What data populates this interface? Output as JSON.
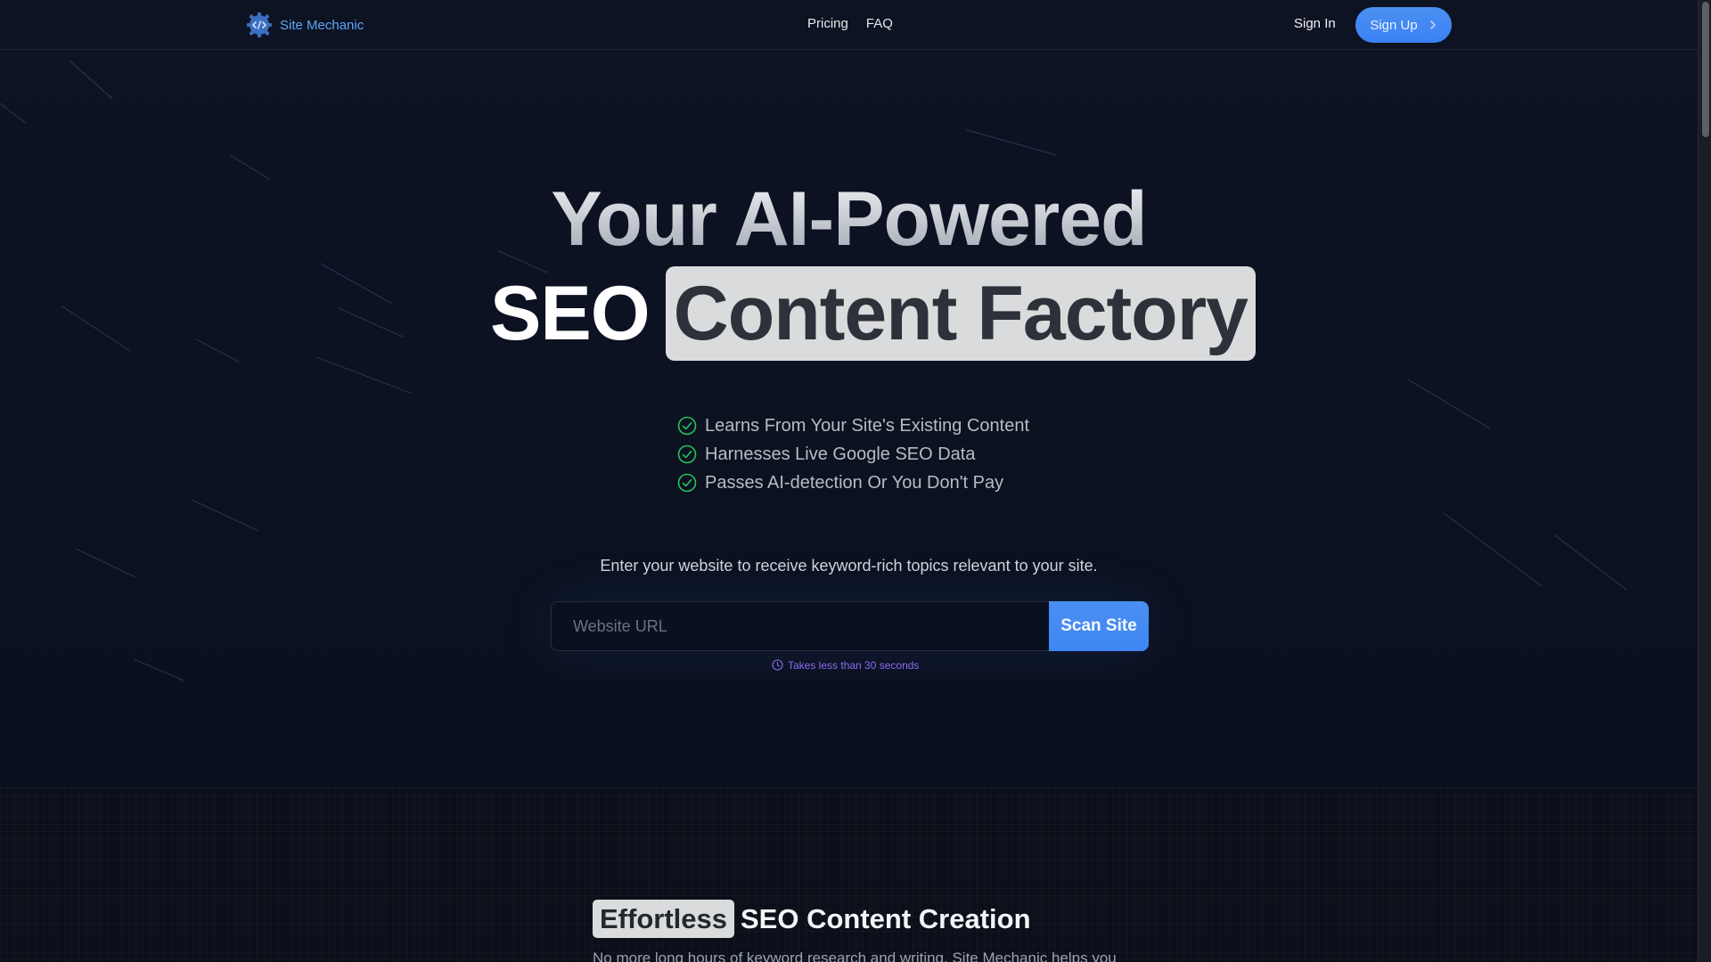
{
  "navbar": {
    "brand": "Site Mechanic",
    "links": [
      "Pricing",
      "FAQ"
    ],
    "sign_in": "Sign In",
    "sign_up": "Sign Up"
  },
  "hero": {
    "line1": "Your AI-Powered",
    "line2_plain": "SEO",
    "line2_highlight": "Content Factory"
  },
  "features": [
    "Learns From Your Site's Existing Content",
    "Harnesses Live Google SEO Data",
    "Passes AI-detection Or You Don't Pay"
  ],
  "scan": {
    "prompt": "Enter your website to receive keyword-rich topics relevant to your site.",
    "placeholder": "Website URL",
    "value": "",
    "button": "Scan Site",
    "hint": "Takes less than 30 seconds"
  },
  "section2": {
    "title_highlight": "Effortless",
    "title_rest": "SEO Content Creation",
    "description": "No more long hours of keyword research and writing. Site Mechanic helps you"
  },
  "colors": {
    "accent": "#3b82f6",
    "background": "#0d1322",
    "check": "#22c55e",
    "hint": "#8b6cf0"
  },
  "icons": {
    "brand": "gear-code-icon",
    "sign_up": "chevron-right-icon",
    "feature": "check-circle-icon",
    "hint": "clock-icon"
  }
}
